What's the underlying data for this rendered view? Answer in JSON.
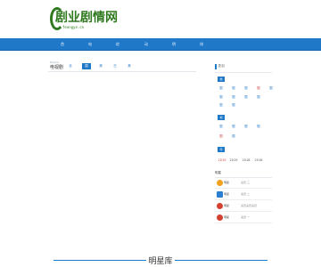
{
  "logo": {
    "title": "剧业剧情网",
    "subtitle": "feongye.cn"
  },
  "nav": {
    "items": [
      "首",
      "电",
      "综",
      "动",
      "明",
      "排"
    ]
  },
  "main": {
    "crumb_small": "Drama",
    "crumb_title": "电视剧",
    "tabs": [
      "全",
      "国",
      "港",
      "日",
      "美"
    ]
  },
  "sidebar": {
    "heading": "剧目",
    "badges": [
      "类",
      "地",
      "年"
    ],
    "genre_tags": [
      "剧",
      "剧",
      "剧",
      "剧",
      "剧",
      "剧",
      "剧",
      "剧",
      "剧",
      "剧"
    ],
    "region_tags": [
      "剧",
      "剧",
      "剧",
      "剧",
      "剧",
      "剧"
    ],
    "years": [
      "2019",
      "2019",
      "2018",
      "2018"
    ],
    "stars_label": "明星",
    "stars": [
      {
        "name": "明星",
        "desc": "演员 三"
      },
      {
        "name": "明星",
        "desc": "演员 二"
      },
      {
        "name": "明星",
        "desc": "演员演员演员"
      },
      {
        "name": "明星",
        "desc": "演员 一"
      }
    ],
    "star_colors": [
      "#f0a21e",
      "#2a7fd0",
      "#d4402f",
      "#d4402f"
    ]
  },
  "footer": {
    "title": "明星库"
  },
  "colors": {
    "brand_blue": "#1f78c8",
    "logo_green": "#2f7a1f"
  }
}
